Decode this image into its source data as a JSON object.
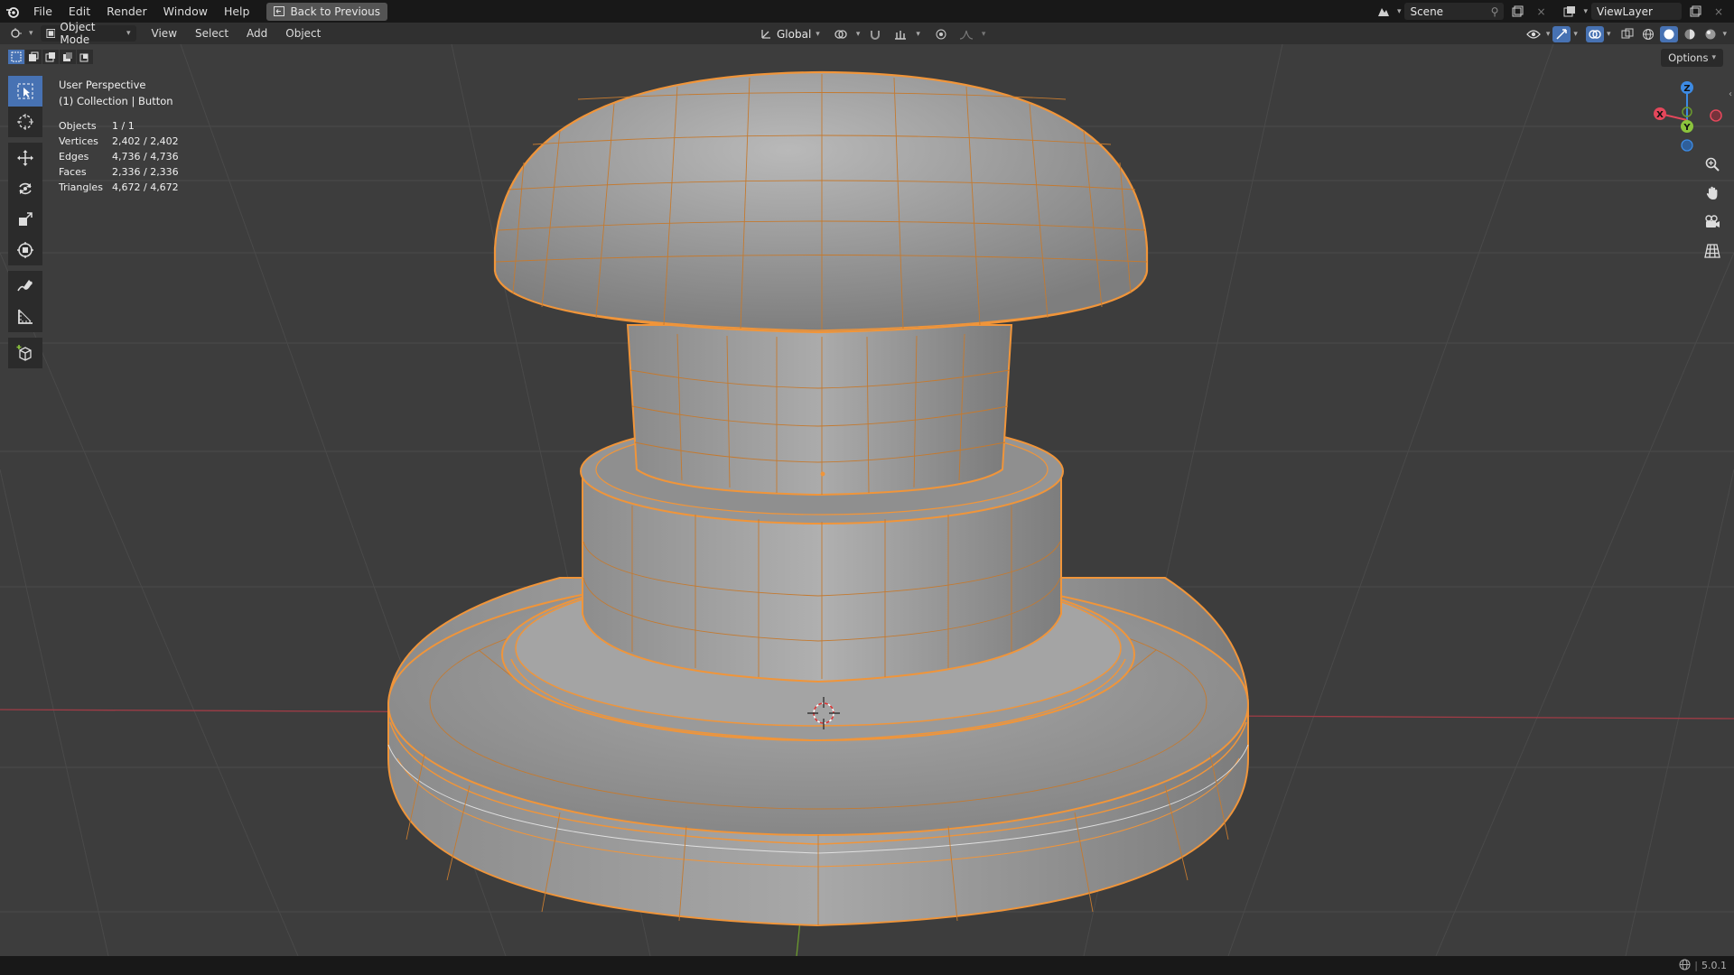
{
  "topbar": {
    "menus": [
      "File",
      "Edit",
      "Render",
      "Window",
      "Help"
    ],
    "back_button": "Back to Previous",
    "scene_name": "Scene",
    "view_layer": "ViewLayer"
  },
  "header": {
    "mode": "Object Mode",
    "menus": [
      "View",
      "Select",
      "Add",
      "Object"
    ],
    "transform_orientation": "Global"
  },
  "viewport": {
    "view_name": "User Perspective",
    "collection_info": "(1) Collection | Button",
    "stats": [
      {
        "label": "Objects",
        "value": "1 / 1"
      },
      {
        "label": "Vertices",
        "value": "2,402 / 2,402"
      },
      {
        "label": "Edges",
        "value": "4,736 / 4,736"
      },
      {
        "label": "Faces",
        "value": "2,336 / 2,336"
      },
      {
        "label": "Triangles",
        "value": "4,672 / 4,672"
      }
    ],
    "options_label": "Options",
    "gizmo_axes": {
      "x": "X",
      "y": "Y",
      "z": "Z"
    },
    "axis_colors": {
      "x": "#e4475b",
      "y": "#8bc43d",
      "z": "#3d8be4"
    },
    "selection_color": "#f0953a"
  },
  "tools": [
    "select-box",
    "cursor",
    "move",
    "rotate",
    "scale",
    "transform",
    "annotate",
    "measure",
    "add-cube"
  ],
  "nav_buttons": [
    "zoom",
    "pan",
    "camera",
    "ortho-grid"
  ],
  "status": {
    "version": "5.0.1"
  }
}
